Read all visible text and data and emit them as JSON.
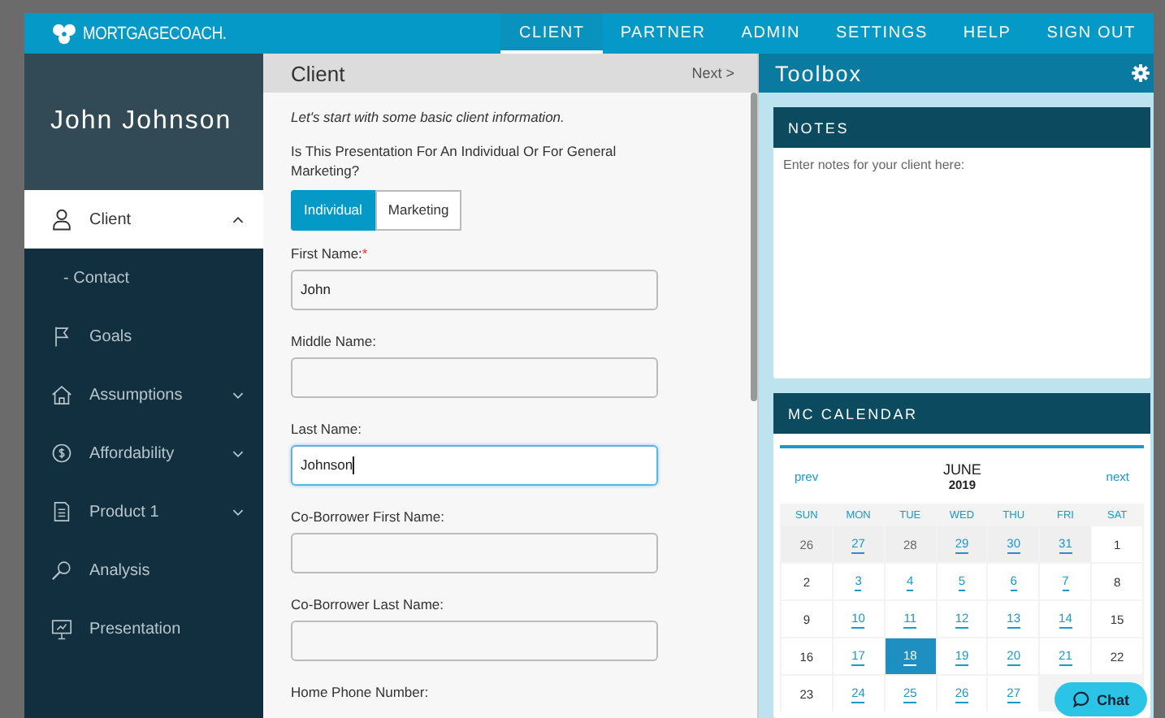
{
  "brand": {
    "name": "MORTGAGECOACH."
  },
  "nav": [
    {
      "label": "CLIENT",
      "selected": true
    },
    {
      "label": "PARTNER",
      "selected": false
    },
    {
      "label": "ADMIN",
      "selected": false
    },
    {
      "label": "SETTINGS",
      "selected": false
    },
    {
      "label": "HELP",
      "selected": false
    },
    {
      "label": "SIGN OUT",
      "selected": false
    }
  ],
  "sidebar": {
    "client_name": "John Johnson",
    "items": [
      {
        "label": "Client",
        "kind": "group",
        "selected": true,
        "expanded": true,
        "children": [
          {
            "label": "- Contact",
            "selected": false
          }
        ]
      },
      {
        "label": "Goals",
        "kind": "link",
        "selected": false
      },
      {
        "label": "Assumptions",
        "kind": "group",
        "selected": false,
        "expanded": false
      },
      {
        "label": "Affordability",
        "kind": "group",
        "selected": false,
        "expanded": false
      },
      {
        "label": "Product 1",
        "kind": "group",
        "selected": false,
        "expanded": false
      },
      {
        "label": "Analysis",
        "kind": "link",
        "selected": false
      },
      {
        "label": "Presentation",
        "kind": "link",
        "selected": false
      }
    ]
  },
  "form": {
    "title": "Client",
    "next": "Next >",
    "intro": "Let's start with some basic client information.",
    "question": "Is This Presentation For An Individual Or For General Marketing?",
    "options": [
      {
        "label": "Individual",
        "selected": true
      },
      {
        "label": "Marketing",
        "selected": false
      }
    ],
    "required_mark": "*",
    "fields": [
      {
        "label": "First Name:",
        "required": true,
        "value": "John",
        "focused": false
      },
      {
        "label": "Middle Name:",
        "required": false,
        "focused": false
      },
      {
        "label": "Last Name:",
        "required": false,
        "value": "Johnson",
        "focused": true
      },
      {
        "label": "Co-Borrower First Name:",
        "required": false,
        "focused": false
      },
      {
        "label": "Co-Borrower Last Name:",
        "required": false,
        "focused": false
      },
      {
        "label": "Home Phone Number:",
        "required": false
      }
    ]
  },
  "toolbox": {
    "title": "Toolbox",
    "notes": {
      "title": "NOTES",
      "placeholder": "Enter notes for your client here:"
    },
    "calendar": {
      "title": "MC CALENDAR",
      "prev": "prev",
      "next": "next",
      "month": "JUNE",
      "year": "2019",
      "weekdays": [
        "SUN",
        "MON",
        "TUE",
        "WED",
        "THU",
        "FRI",
        "SAT"
      ],
      "weeks": [
        [
          {
            "day": "26",
            "other_month": true,
            "linked": false,
            "selected": false
          },
          {
            "day": "27",
            "other_month": true,
            "linked": true,
            "selected": false
          },
          {
            "day": "28",
            "other_month": true,
            "linked": false,
            "selected": false
          },
          {
            "day": "29",
            "other_month": true,
            "linked": true,
            "selected": false
          },
          {
            "day": "30",
            "other_month": true,
            "linked": true,
            "selected": false
          },
          {
            "day": "31",
            "other_month": true,
            "linked": true,
            "selected": false
          },
          {
            "day": "1",
            "other_month": false,
            "linked": false,
            "selected": false
          }
        ],
        [
          {
            "day": "2",
            "other_month": false,
            "linked": false,
            "selected": false
          },
          {
            "day": "3",
            "other_month": false,
            "linked": true,
            "selected": false
          },
          {
            "day": "4",
            "other_month": false,
            "linked": true,
            "selected": false
          },
          {
            "day": "5",
            "other_month": false,
            "linked": true,
            "selected": false
          },
          {
            "day": "6",
            "other_month": false,
            "linked": true,
            "selected": false
          },
          {
            "day": "7",
            "other_month": false,
            "linked": true,
            "selected": false
          },
          {
            "day": "8",
            "other_month": false,
            "linked": false,
            "selected": false
          }
        ],
        [
          {
            "day": "9",
            "other_month": false,
            "linked": false,
            "selected": false
          },
          {
            "day": "10",
            "other_month": false,
            "linked": true,
            "selected": false
          },
          {
            "day": "11",
            "other_month": false,
            "linked": true,
            "selected": false
          },
          {
            "day": "12",
            "other_month": false,
            "linked": true,
            "selected": false
          },
          {
            "day": "13",
            "other_month": false,
            "linked": true,
            "selected": false
          },
          {
            "day": "14",
            "other_month": false,
            "linked": true,
            "selected": false
          },
          {
            "day": "15",
            "other_month": false,
            "linked": false,
            "selected": false
          }
        ],
        [
          {
            "day": "16",
            "other_month": false,
            "linked": false,
            "selected": false
          },
          {
            "day": "17",
            "other_month": false,
            "linked": true,
            "selected": false
          },
          {
            "day": "18",
            "other_month": false,
            "linked": true,
            "selected": true
          },
          {
            "day": "19",
            "other_month": false,
            "linked": true,
            "selected": false
          },
          {
            "day": "20",
            "other_month": false,
            "linked": true,
            "selected": false
          },
          {
            "day": "21",
            "other_month": false,
            "linked": true,
            "selected": false
          },
          {
            "day": "22",
            "other_month": false,
            "linked": false,
            "selected": false
          }
        ],
        [
          {
            "day": "23",
            "other_month": false,
            "linked": false,
            "selected": false
          },
          {
            "day": "24",
            "other_month": false,
            "linked": true,
            "selected": false
          },
          {
            "day": "25",
            "other_month": false,
            "linked": true,
            "selected": false
          },
          {
            "day": "26",
            "other_month": false,
            "linked": true,
            "selected": false
          },
          {
            "day": "27",
            "other_month": false,
            "linked": true,
            "selected": false
          }
        ]
      ]
    },
    "chat": {
      "label": "Chat"
    }
  }
}
